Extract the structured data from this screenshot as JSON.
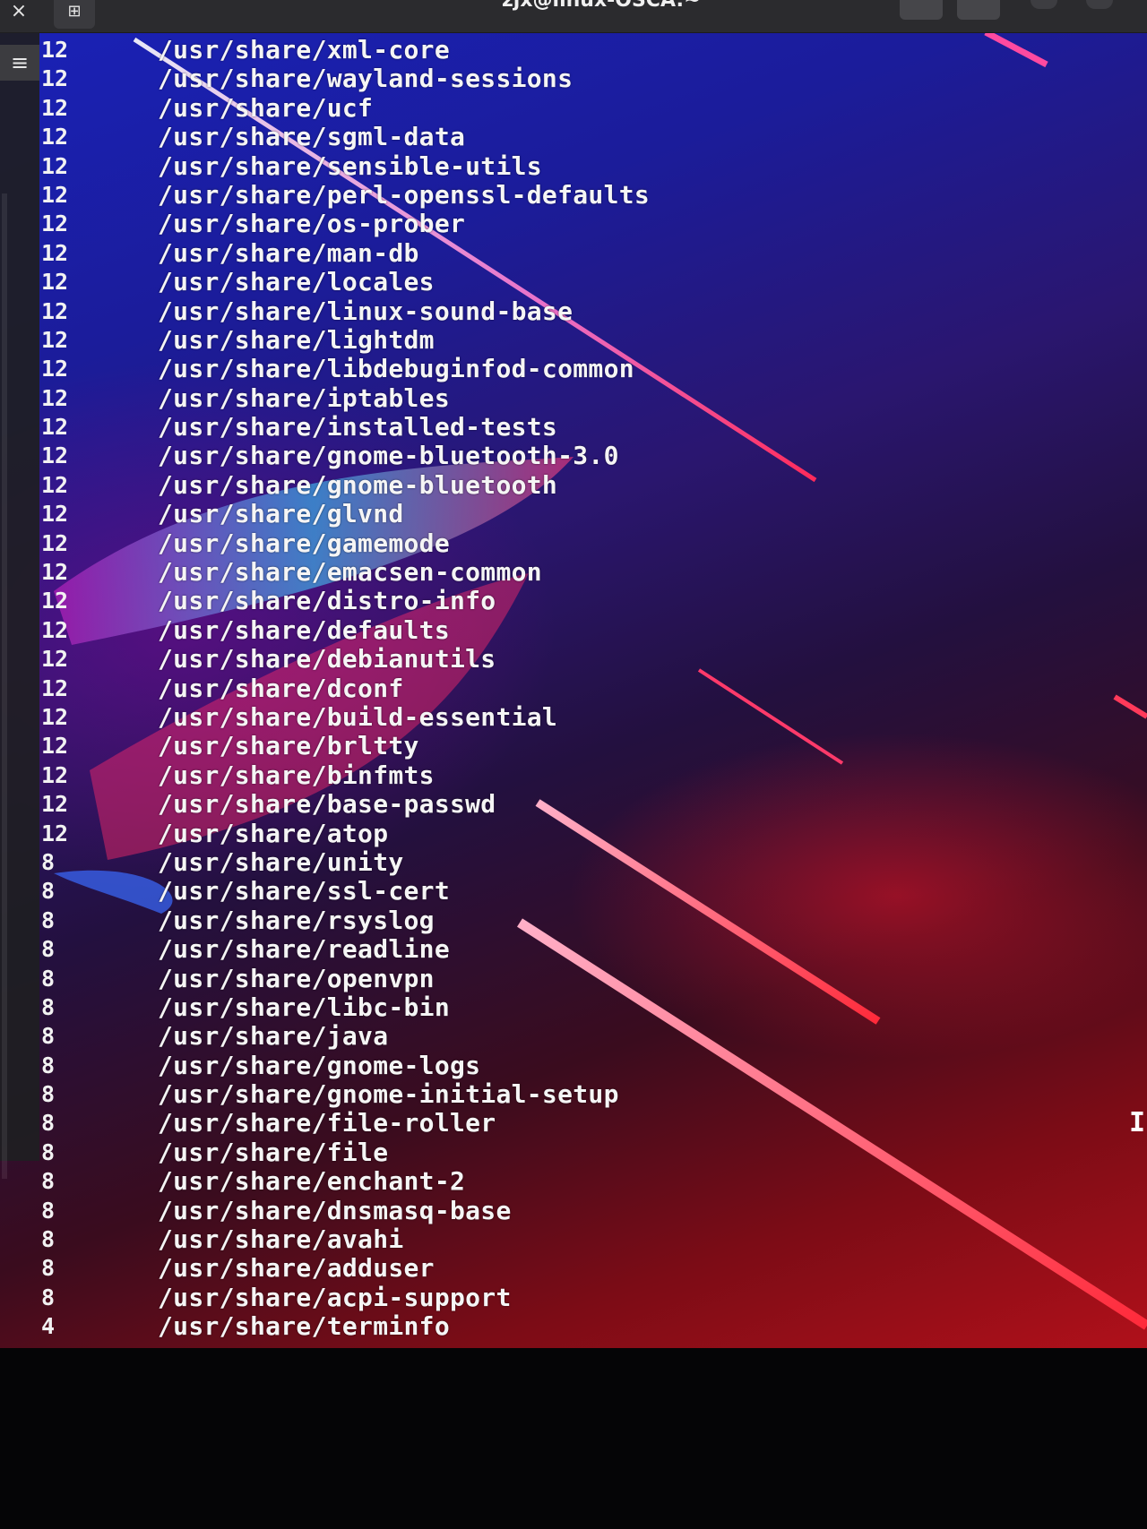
{
  "window": {
    "title": "zjx@linux-OSCA:~",
    "close_glyph": "×",
    "new_tab_glyph": "⊞",
    "menu_glyph": "≡"
  },
  "terminal": {
    "rows": [
      {
        "size": "12",
        "path": "/usr/share/xml-core"
      },
      {
        "size": "12",
        "path": "/usr/share/wayland-sessions"
      },
      {
        "size": "12",
        "path": "/usr/share/ucf"
      },
      {
        "size": "12",
        "path": "/usr/share/sgml-data"
      },
      {
        "size": "12",
        "path": "/usr/share/sensible-utils"
      },
      {
        "size": "12",
        "path": "/usr/share/perl-openssl-defaults"
      },
      {
        "size": "12",
        "path": "/usr/share/os-prober"
      },
      {
        "size": "12",
        "path": "/usr/share/man-db"
      },
      {
        "size": "12",
        "path": "/usr/share/locales"
      },
      {
        "size": "12",
        "path": "/usr/share/linux-sound-base"
      },
      {
        "size": "12",
        "path": "/usr/share/lightdm"
      },
      {
        "size": "12",
        "path": "/usr/share/libdebuginfod-common"
      },
      {
        "size": "12",
        "path": "/usr/share/iptables"
      },
      {
        "size": "12",
        "path": "/usr/share/installed-tests"
      },
      {
        "size": "12",
        "path": "/usr/share/gnome-bluetooth-3.0"
      },
      {
        "size": "12",
        "path": "/usr/share/gnome-bluetooth"
      },
      {
        "size": "12",
        "path": "/usr/share/glvnd"
      },
      {
        "size": "12",
        "path": "/usr/share/gamemode"
      },
      {
        "size": "12",
        "path": "/usr/share/emacsen-common"
      },
      {
        "size": "12",
        "path": "/usr/share/distro-info"
      },
      {
        "size": "12",
        "path": "/usr/share/defaults"
      },
      {
        "size": "12",
        "path": "/usr/share/debianutils"
      },
      {
        "size": "12",
        "path": "/usr/share/dconf"
      },
      {
        "size": "12",
        "path": "/usr/share/build-essential"
      },
      {
        "size": "12",
        "path": "/usr/share/brltty"
      },
      {
        "size": "12",
        "path": "/usr/share/binfmts"
      },
      {
        "size": "12",
        "path": "/usr/share/base-passwd"
      },
      {
        "size": "12",
        "path": "/usr/share/atop"
      },
      {
        "size": "8",
        "path": "/usr/share/unity"
      },
      {
        "size": "8",
        "path": "/usr/share/ssl-cert"
      },
      {
        "size": "8",
        "path": "/usr/share/rsyslog"
      },
      {
        "size": "8",
        "path": "/usr/share/readline"
      },
      {
        "size": "8",
        "path": "/usr/share/openvpn"
      },
      {
        "size": "8",
        "path": "/usr/share/libc-bin"
      },
      {
        "size": "8",
        "path": "/usr/share/java"
      },
      {
        "size": "8",
        "path": "/usr/share/gnome-logs"
      },
      {
        "size": "8",
        "path": "/usr/share/gnome-initial-setup"
      },
      {
        "size": "8",
        "path": "/usr/share/file-roller"
      },
      {
        "size": "8",
        "path": "/usr/share/file"
      },
      {
        "size": "8",
        "path": "/usr/share/enchant-2"
      },
      {
        "size": "8",
        "path": "/usr/share/dnsmasq-base"
      },
      {
        "size": "8",
        "path": "/usr/share/avahi"
      },
      {
        "size": "8",
        "path": "/usr/share/adduser"
      },
      {
        "size": "8",
        "path": "/usr/share/acpi-support"
      },
      {
        "size": "4",
        "path": "/usr/share/terminfo"
      }
    ]
  },
  "mouse_cursor_glyph": "I",
  "colors": {
    "text": "#f5f5f5",
    "titlebar": "#2b2b2e",
    "wallpaper_blue": "#1a22b8",
    "wallpaper_red": "#b0101a",
    "neon_pink": "#ff3d8a"
  }
}
